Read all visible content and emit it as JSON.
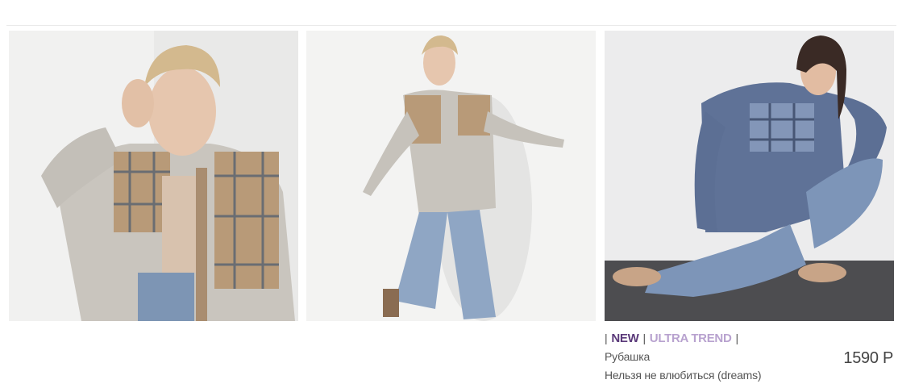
{
  "products": [
    {
      "image_alt": "model in beige plaid shirt, close-up"
    },
    {
      "image_alt": "model in beige plaid shirt, full length"
    },
    {
      "image_alt": "model in blue plaid shirt, kneeling"
    }
  ],
  "product_info": {
    "tag_new": "NEW",
    "tag_trend": "ULTRA TREND",
    "separator": "|",
    "type": "Рубашка",
    "name": "Нельзя не влюбиться (dreams)",
    "price": "1590 Р"
  },
  "colors": {
    "tag_new": "#5b3a7a",
    "tag_trend": "#b8a2cf"
  }
}
